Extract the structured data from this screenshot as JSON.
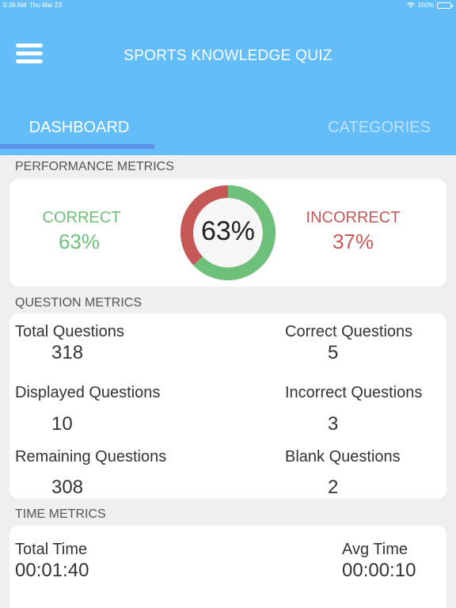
{
  "status_bar": {
    "time": "5:39 AM",
    "date": "Thu Mar 23",
    "battery": "100%",
    "icons": [
      "wifi-icon",
      "battery-icon"
    ]
  },
  "header": {
    "title": "SPORTS KNOWLEDGE QUIZ",
    "menu_icon": "hamburger-menu-icon"
  },
  "tabs": [
    {
      "label": "DASHBOARD",
      "active": true
    },
    {
      "label": "CATEGORIES",
      "active": false
    }
  ],
  "performance": {
    "section_title": "PERFORMANCE METRICS",
    "correct_label": "CORRECT",
    "correct_value": "63%",
    "incorrect_label": "INCORRECT",
    "incorrect_value": "37%",
    "donut_text": "63%",
    "correct_fraction": 0.63,
    "colors": {
      "correct": "#6cc07a",
      "incorrect": "#c65757"
    }
  },
  "questions": {
    "section_title": "QUESTION METRICS",
    "items": [
      {
        "label": "Total Questions",
        "value": "318"
      },
      {
        "label": "Correct Questions",
        "value": "5"
      },
      {
        "label": "Displayed Questions",
        "value": "10"
      },
      {
        "label": "Incorrect Questions",
        "value": "3"
      },
      {
        "label": "Remaining Questions",
        "value": "308"
      },
      {
        "label": "Blank Questions",
        "value": "2"
      }
    ]
  },
  "time": {
    "section_title": "TIME METRICS",
    "total_label": "Total Time",
    "total_value": "00:01:40",
    "avg_label": "Avg Time",
    "avg_value": "00:00:10"
  },
  "colors": {
    "header": "#63bdf8",
    "tab_indicator": "#5c92e6",
    "background": "#efefef"
  }
}
